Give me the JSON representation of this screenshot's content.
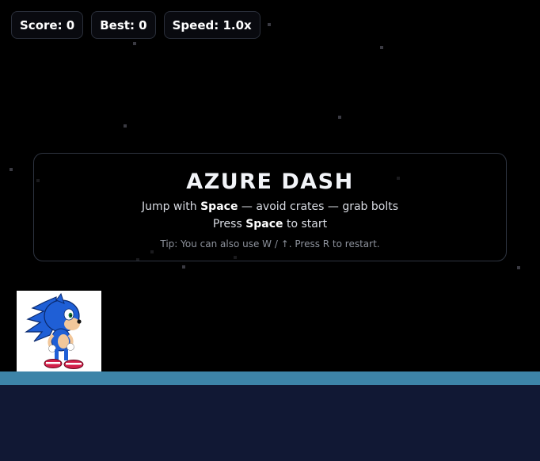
{
  "hud": {
    "score_label": "Score: 0",
    "best_label": "Best: 0",
    "speed_label": "Speed: 1.0x"
  },
  "overlay": {
    "title": "AZURE DASH",
    "line1_prefix": "Jump with ",
    "line1_key": "Space",
    "line1_suffix": " — avoid crates — grab bolts",
    "line2_prefix": "Press ",
    "line2_key": "Space",
    "line2_suffix": " to start",
    "tip": "Tip: You can also use W / ↑. Press R to restart."
  },
  "player": {
    "icon": "hedgehog-sprite-icon"
  },
  "colors": {
    "background": "#000000",
    "ground_top": "#3d84a8",
    "ground": "#111834",
    "hero_blue": "#1f5fd6",
    "shoe_red": "#d4204a"
  }
}
